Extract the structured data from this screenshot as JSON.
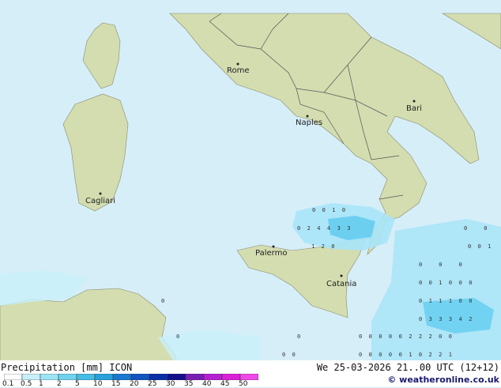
{
  "legend": {
    "title": "Precipitation [mm]  ICON",
    "datetime": "We 25-03-2026 21..00 UTC (12+12)",
    "credit": "© weatheronline.co.uk",
    "ticks": [
      "0.1",
      "0.5",
      "1",
      "2",
      "5",
      "10",
      "15",
      "20",
      "25",
      "30",
      "35",
      "40",
      "45",
      "50"
    ],
    "colors": [
      "#ffffff",
      "#c8f0fa",
      "#9be4f5",
      "#6fd3ee",
      "#45bde6",
      "#2a9fdc",
      "#1a78d0",
      "#1255c0",
      "#0a30a8",
      "#14108c",
      "#7a1fb4",
      "#b41fd0",
      "#dc1fd8",
      "#f048e8"
    ]
  },
  "colors": {
    "sea": "#d6eef8",
    "land": "#d8e2b4",
    "rain": "#a8e4f8",
    "rain_heavy": "#6ccff0"
  },
  "cities": [
    {
      "name": "Rome"
    },
    {
      "name": "Bari"
    },
    {
      "name": "Naples"
    },
    {
      "name": "Cagliari"
    },
    {
      "name": "Palermo"
    },
    {
      "name": "Catania"
    }
  ],
  "values": {
    "r1": "0  0  1  0",
    "r2": "0  2  4  4  3  3",
    "r3": "1  2  0",
    "e1": "0     0",
    "e2": "0  0  1",
    "e3": "0     0     0",
    "e4": "0  0  1  0  0  0",
    "e5": "0  1  1  1  0  0",
    "e6": "0  3  3  3  4  2",
    "e7": "0  0  0  0  0  2  2  2  0  0",
    "e8": "0  0  0  0  0  1  0  2  2  1",
    "w1": "0",
    "w2": "0",
    "w3": "0",
    "w4": "0  0"
  }
}
